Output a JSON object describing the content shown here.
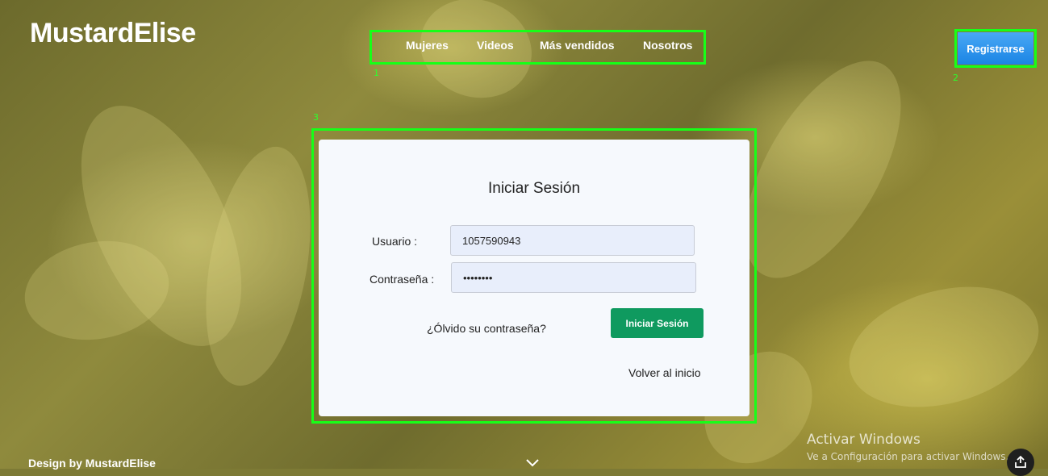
{
  "brand": {
    "logo": "MustardElise"
  },
  "nav": {
    "items": [
      "Mujeres",
      "Videos",
      "Más vendidos",
      "Nosotros"
    ]
  },
  "header": {
    "register_label": "Registrarse"
  },
  "annotations": {
    "box1": "1",
    "box2": "2",
    "box3": "3"
  },
  "login": {
    "title": "Iniciar Sesión",
    "user_label": "Usuario :",
    "user_value": "1057590943",
    "password_label": "Contraseña :",
    "password_value": "••••••••",
    "forgot_label": "¿Ólvido su contraseña?",
    "submit_label": "Iniciar Sesión",
    "back_label": "Volver al inicio"
  },
  "footer": {
    "credit": "Design by MustardElise"
  },
  "windows_watermark": {
    "title": "Activar Windows",
    "subtitle": "Ve a Configuración para activar Windows."
  },
  "colors": {
    "accent_green": "#0f9a5f",
    "register_blue": "#1a84e4",
    "annotation_green": "#17ff17"
  },
  "icons": {
    "scroll_down": "chevron-down-icon",
    "share": "share-icon"
  }
}
